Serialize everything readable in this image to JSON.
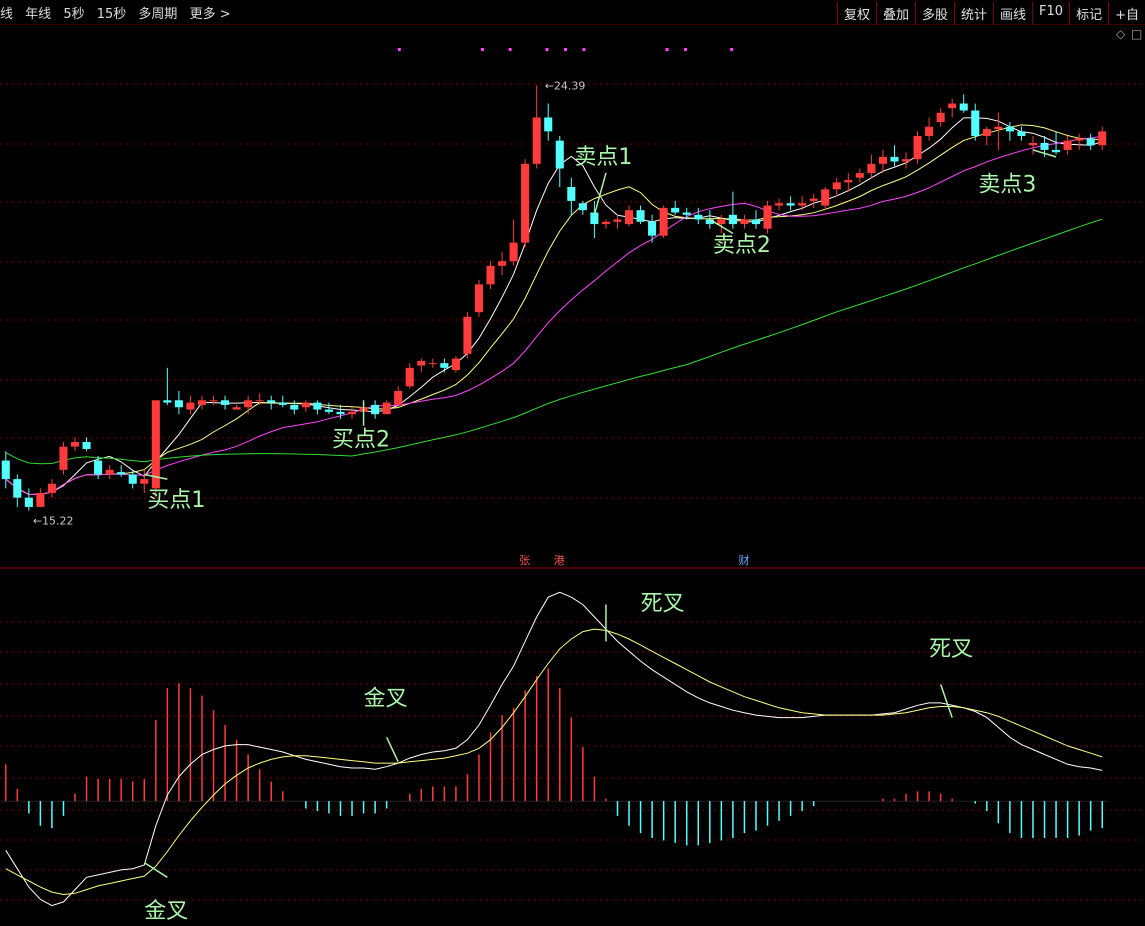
{
  "toolbar": {
    "left_items": [
      "线",
      "年线",
      "5秒",
      "15秒",
      "多周期",
      "更多 >"
    ],
    "right_items": [
      "复权",
      "叠加",
      "多股",
      "统计",
      "画线",
      "F10",
      "标记",
      "+自"
    ]
  },
  "colors": {
    "up": "#ff3b3b",
    "down": "#54ffff",
    "ma5": "#ffffff",
    "ma10": "#ffff80",
    "ma20": "#ff44ff",
    "ma60": "#33dd33",
    "annotation": "#a9f5a9",
    "grid": "#7a0000"
  },
  "chart_data": [
    {
      "type": "candlestick",
      "title": "",
      "price_high_label": "24.39",
      "price_low_label": "15.22",
      "ylim": [
        14.5,
        25.5
      ],
      "candles": [
        [
          16.3,
          16.5,
          15.7,
          15.9
        ],
        [
          15.9,
          16.0,
          15.3,
          15.5
        ],
        [
          15.5,
          15.7,
          15.22,
          15.3
        ],
        [
          15.3,
          15.7,
          15.3,
          15.6
        ],
        [
          15.6,
          15.9,
          15.5,
          15.8
        ],
        [
          16.1,
          16.7,
          16.0,
          16.6
        ],
        [
          16.6,
          16.8,
          16.5,
          16.7
        ],
        [
          16.7,
          16.8,
          16.5,
          16.55
        ],
        [
          16.3,
          16.4,
          15.9,
          16.0
        ],
        [
          16.0,
          16.2,
          15.9,
          16.1
        ],
        [
          16.05,
          16.2,
          15.95,
          16.0
        ],
        [
          16.0,
          16.1,
          15.7,
          15.8
        ],
        [
          15.8,
          16.1,
          15.6,
          15.9
        ],
        [
          15.7,
          16.9,
          15.5,
          17.6
        ],
        [
          17.6,
          18.3,
          17.5,
          17.55
        ],
        [
          17.6,
          17.8,
          17.3,
          17.45
        ],
        [
          17.4,
          17.7,
          17.3,
          17.55
        ],
        [
          17.5,
          17.7,
          17.4,
          17.6
        ],
        [
          17.6,
          17.7,
          17.5,
          17.6
        ],
        [
          17.6,
          17.7,
          17.4,
          17.5
        ],
        [
          17.4,
          17.5,
          17.4,
          17.45
        ],
        [
          17.45,
          17.7,
          17.3,
          17.6
        ],
        [
          17.6,
          17.75,
          17.5,
          17.6
        ],
        [
          17.6,
          17.7,
          17.4,
          17.55
        ],
        [
          17.55,
          17.7,
          17.45,
          17.5
        ],
        [
          17.5,
          17.6,
          17.3,
          17.4
        ],
        [
          17.45,
          17.6,
          17.35,
          17.55
        ],
        [
          17.55,
          17.6,
          17.3,
          17.4
        ],
        [
          17.4,
          17.55,
          17.3,
          17.35
        ],
        [
          17.35,
          17.5,
          17.2,
          17.3
        ],
        [
          17.3,
          17.45,
          17.2,
          17.35
        ],
        [
          17.35,
          17.5,
          17.25,
          17.45
        ],
        [
          17.5,
          17.6,
          17.2,
          17.3
        ],
        [
          17.3,
          17.6,
          17.3,
          17.55
        ],
        [
          17.5,
          17.9,
          17.5,
          17.8
        ],
        [
          17.9,
          18.4,
          17.85,
          18.3
        ],
        [
          18.35,
          18.5,
          18.2,
          18.45
        ],
        [
          18.4,
          18.5,
          18.3,
          18.4
        ],
        [
          18.4,
          18.5,
          18.2,
          18.3
        ],
        [
          18.25,
          18.55,
          18.2,
          18.5
        ],
        [
          18.6,
          19.5,
          18.5,
          19.4
        ],
        [
          19.5,
          20.2,
          19.4,
          20.1
        ],
        [
          20.1,
          20.6,
          20.0,
          20.5
        ],
        [
          20.5,
          20.8,
          20.3,
          20.6
        ],
        [
          20.6,
          21.5,
          20.5,
          21.0
        ],
        [
          21.0,
          22.8,
          20.9,
          22.7
        ],
        [
          22.7,
          24.39,
          22.6,
          23.7
        ],
        [
          23.7,
          24.0,
          23.2,
          23.4
        ],
        [
          23.2,
          23.3,
          22.2,
          22.6
        ],
        [
          22.2,
          22.4,
          21.6,
          21.9
        ],
        [
          21.85,
          21.9,
          21.6,
          21.7
        ],
        [
          21.65,
          21.9,
          21.1,
          21.4
        ],
        [
          21.4,
          21.5,
          21.3,
          21.45
        ],
        [
          21.45,
          21.6,
          21.3,
          21.5
        ],
        [
          21.4,
          21.8,
          21.35,
          21.7
        ],
        [
          21.7,
          21.8,
          21.4,
          21.45
        ],
        [
          21.45,
          21.6,
          21.0,
          21.15
        ],
        [
          21.15,
          21.8,
          21.1,
          21.75
        ],
        [
          21.75,
          21.9,
          21.6,
          21.65
        ],
        [
          21.65,
          21.75,
          21.5,
          21.6
        ],
        [
          21.6,
          21.75,
          21.4,
          21.5
        ],
        [
          21.5,
          21.7,
          21.3,
          21.4
        ],
        [
          21.4,
          21.6,
          21.2,
          21.5
        ],
        [
          21.6,
          22.1,
          21.3,
          21.4
        ],
        [
          21.4,
          21.6,
          21.3,
          21.5
        ],
        [
          21.5,
          21.7,
          21.3,
          21.4
        ],
        [
          21.3,
          21.9,
          21.2,
          21.8
        ],
        [
          21.8,
          21.95,
          21.7,
          21.85
        ],
        [
          21.85,
          22.0,
          21.7,
          21.8
        ],
        [
          21.8,
          22.0,
          21.7,
          21.85
        ],
        [
          21.9,
          22.05,
          21.75,
          21.95
        ],
        [
          21.8,
          22.2,
          21.7,
          22.15
        ],
        [
          22.15,
          22.4,
          22.0,
          22.3
        ],
        [
          22.3,
          22.5,
          22.1,
          22.35
        ],
        [
          22.4,
          22.6,
          22.3,
          22.5
        ],
        [
          22.5,
          22.9,
          22.4,
          22.7
        ],
        [
          22.7,
          23.0,
          22.5,
          22.85
        ],
        [
          22.85,
          23.1,
          22.65,
          22.75
        ],
        [
          22.75,
          22.95,
          22.6,
          22.8
        ],
        [
          22.8,
          23.4,
          22.7,
          23.3
        ],
        [
          23.3,
          23.7,
          23.2,
          23.5
        ],
        [
          23.6,
          23.9,
          23.5,
          23.8
        ],
        [
          23.9,
          24.1,
          23.7,
          24.0
        ],
        [
          24.0,
          24.2,
          23.8,
          23.85
        ],
        [
          23.85,
          24.0,
          23.2,
          23.3
        ],
        [
          23.3,
          23.5,
          23.1,
          23.45
        ],
        [
          23.45,
          23.8,
          23.0,
          23.5
        ],
        [
          23.5,
          23.6,
          23.2,
          23.4
        ],
        [
          23.4,
          23.5,
          23.2,
          23.3
        ],
        [
          23.1,
          23.3,
          22.9,
          23.15
        ],
        [
          23.15,
          23.3,
          22.85,
          23.0
        ],
        [
          23.0,
          23.4,
          22.9,
          22.95
        ],
        [
          23.0,
          23.3,
          22.9,
          23.2
        ],
        [
          23.2,
          23.35,
          23.0,
          23.25
        ],
        [
          23.25,
          23.35,
          23.0,
          23.1
        ],
        [
          23.1,
          23.5,
          23.0,
          23.4
        ]
      ],
      "ma_lines": [
        {
          "key": "ma5",
          "period": 5
        },
        {
          "key": "ma10",
          "period": 10
        },
        {
          "key": "ma20",
          "period": 20
        },
        {
          "key": "ma60",
          "period": 60
        }
      ],
      "annotations": [
        {
          "text": "买点1",
          "index": 14,
          "price": 15.3,
          "arrow_from": [
            12,
            16.0
          ],
          "arrow_to": [
            14,
            15.9
          ]
        },
        {
          "text": "买点2",
          "index": 30,
          "price": 16.6,
          "arrow_from": [
            31,
            17.6
          ],
          "arrow_to": [
            31,
            17.05
          ]
        },
        {
          "text": "卖点1",
          "index": 51,
          "price": 22.7,
          "arrow_from": [
            52,
            22.5
          ],
          "arrow_to": [
            51,
            21.6
          ]
        },
        {
          "text": "卖点2",
          "index": 63,
          "price": 20.8,
          "arrow_from": [
            61,
            21.5
          ],
          "arrow_to": [
            63,
            21.2
          ]
        },
        {
          "text": "卖点3",
          "index": 86,
          "price": 22.1,
          "arrow_from": [
            89,
            23.0
          ],
          "arrow_to": [
            91,
            22.85
          ]
        }
      ],
      "event_badges": [
        {
          "text": "张",
          "index": 45,
          "color": "#ff5050"
        },
        {
          "text": "港",
          "index": 48,
          "color": "#ff5050"
        },
        {
          "text": "财",
          "index": 64,
          "color": "#6fa8ff"
        }
      ],
      "top_marker_indices": [
        35,
        44,
        47,
        51,
        53,
        55,
        64,
        66,
        71
      ]
    },
    {
      "type": "macd",
      "title": "",
      "ylim": [
        -1.0,
        1.8
      ],
      "dif": [
        -0.4,
        -0.55,
        -0.7,
        -0.8,
        -0.85,
        -0.82,
        -0.72,
        -0.62,
        -0.6,
        -0.58,
        -0.56,
        -0.55,
        -0.52,
        -0.2,
        0.05,
        0.2,
        0.3,
        0.38,
        0.42,
        0.45,
        0.46,
        0.46,
        0.44,
        0.42,
        0.4,
        0.37,
        0.34,
        0.32,
        0.3,
        0.28,
        0.27,
        0.27,
        0.26,
        0.28,
        0.31,
        0.35,
        0.38,
        0.4,
        0.41,
        0.43,
        0.5,
        0.62,
        0.78,
        0.95,
        1.1,
        1.3,
        1.5,
        1.66,
        1.7,
        1.66,
        1.6,
        1.5,
        1.4,
        1.3,
        1.22,
        1.14,
        1.07,
        1.01,
        0.95,
        0.89,
        0.84,
        0.8,
        0.77,
        0.74,
        0.72,
        0.7,
        0.69,
        0.68,
        0.68,
        0.68,
        0.69,
        0.7,
        0.7,
        0.7,
        0.7,
        0.7,
        0.71,
        0.72,
        0.75,
        0.78,
        0.8,
        0.8,
        0.78,
        0.76,
        0.73,
        0.68,
        0.6,
        0.52,
        0.46,
        0.42,
        0.38,
        0.34,
        0.3,
        0.28,
        0.27,
        0.25
      ],
      "dea": [
        -0.55,
        -0.6,
        -0.65,
        -0.7,
        -0.74,
        -0.76,
        -0.75,
        -0.72,
        -0.69,
        -0.67,
        -0.65,
        -0.63,
        -0.61,
        -0.53,
        -0.41,
        -0.28,
        -0.16,
        -0.05,
        0.05,
        0.14,
        0.21,
        0.27,
        0.31,
        0.34,
        0.36,
        0.37,
        0.37,
        0.36,
        0.35,
        0.34,
        0.33,
        0.32,
        0.31,
        0.31,
        0.31,
        0.32,
        0.33,
        0.34,
        0.35,
        0.37,
        0.39,
        0.43,
        0.5,
        0.6,
        0.72,
        0.85,
        0.99,
        1.12,
        1.24,
        1.32,
        1.38,
        1.4,
        1.39,
        1.36,
        1.32,
        1.27,
        1.22,
        1.17,
        1.12,
        1.07,
        1.02,
        0.97,
        0.93,
        0.89,
        0.85,
        0.82,
        0.79,
        0.76,
        0.74,
        0.72,
        0.71,
        0.7,
        0.7,
        0.7,
        0.7,
        0.7,
        0.7,
        0.71,
        0.72,
        0.74,
        0.76,
        0.77,
        0.77,
        0.76,
        0.74,
        0.72,
        0.69,
        0.65,
        0.61,
        0.57,
        0.53,
        0.49,
        0.45,
        0.42,
        0.39,
        0.36
      ],
      "labels": [
        {
          "text": "金叉",
          "index": 12,
          "value": -0.95,
          "arrow_from": [
            12,
            -0.5
          ],
          "arrow_to": [
            14,
            -0.62
          ]
        },
        {
          "text": "金叉",
          "index": 31,
          "value": 0.78,
          "arrow_from": [
            33,
            0.52
          ],
          "arrow_to": [
            34,
            0.32
          ]
        },
        {
          "text": "死叉",
          "index": 55,
          "value": 1.55,
          "arrow_from": [
            52,
            1.6
          ],
          "arrow_to": [
            52,
            1.3
          ]
        },
        {
          "text": "死叉",
          "index": 80,
          "value": 1.18,
          "arrow_from": [
            81,
            0.95
          ],
          "arrow_to": [
            82,
            0.68
          ]
        }
      ]
    }
  ]
}
